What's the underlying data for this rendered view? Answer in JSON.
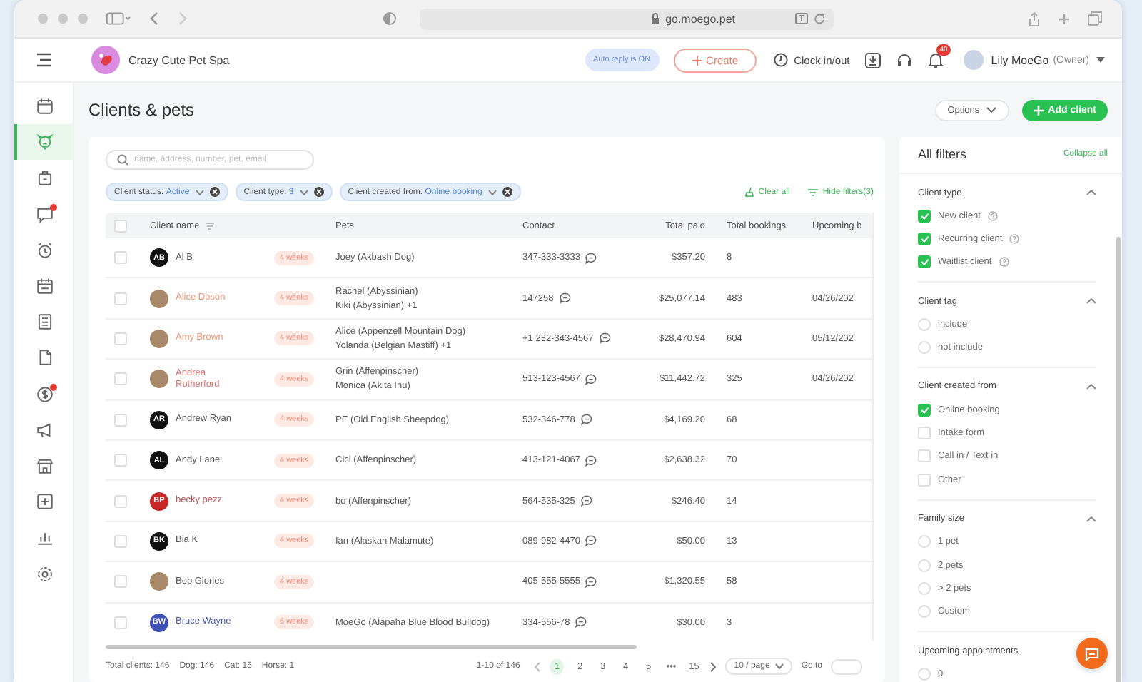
{
  "browser": {
    "url": "go.moego.pet"
  },
  "header": {
    "business": "Crazy Cute Pet Spa",
    "auto_reply": "Auto reply is ON",
    "create": "Create",
    "clock": "Clock in/out",
    "notifications": "40",
    "user": "Lily MoeGo",
    "role": "(Owner)"
  },
  "sidebar": {
    "items": [
      {
        "selected": false,
        "dot": false
      },
      {
        "selected": true,
        "dot": false
      },
      {
        "selected": false,
        "dot": false
      },
      {
        "selected": false,
        "dot": true
      },
      {
        "selected": false,
        "dot": false
      },
      {
        "selected": false,
        "dot": false
      },
      {
        "selected": false,
        "dot": false
      },
      {
        "selected": false,
        "dot": false
      },
      {
        "selected": false,
        "dot": true
      },
      {
        "selected": false,
        "dot": false
      },
      {
        "selected": false,
        "dot": false
      },
      {
        "selected": false,
        "dot": false
      },
      {
        "selected": false,
        "dot": false
      },
      {
        "selected": false,
        "dot": false
      }
    ]
  },
  "page": {
    "title": "Clients & pets",
    "options": "Options",
    "add_client": "Add client"
  },
  "search": {
    "placeholder": "name, address, number, pet, email"
  },
  "filter_chips": [
    {
      "label": "Client status:",
      "value": "Active"
    },
    {
      "label": "Client type:",
      "value": "3"
    },
    {
      "label": "Client created from:",
      "value": "Online booking"
    }
  ],
  "clear_all": "Clear all",
  "hide_filters": "Hide filters(3)",
  "table": {
    "select_all": false,
    "columns": [
      "Client name",
      "Pets",
      "Contact",
      "Total paid",
      "Total bookings",
      "Upcoming b"
    ],
    "rows": [
      {
        "selected": false,
        "name": "Al B",
        "color": "#555555",
        "avatar": {
          "kind": "initials",
          "initials": "AB",
          "color": "#111111"
        },
        "frequency": "4 weeks",
        "pets": [
          "Joey (Akbash Dog)"
        ],
        "contact": "347-333-3333",
        "total_paid": "$357.20",
        "total_bookings": "8"
      },
      {
        "selected": false,
        "name": "Alice Doson",
        "color": "#f09373",
        "avatar": {
          "kind": "photo"
        },
        "frequency": "4 weeks",
        "pets": [
          "Rachel (Abyssinian)",
          "Kiki (Abyssinian) +1"
        ],
        "contact": "147258",
        "total_paid": "$25,077.14",
        "total_bookings": "483",
        "upcoming": "04/26/202"
      },
      {
        "selected": false,
        "name": "Amy Brown",
        "color": "#f09373",
        "avatar": {
          "kind": "photo"
        },
        "frequency": "4 weeks",
        "pets": [
          "Alice (Appenzell Mountain Dog)",
          "Yolanda (Belgian Mastiff) +1"
        ],
        "contact": "+1 232-343-4567",
        "total_paid": "$28,470.94",
        "total_bookings": "604",
        "upcoming": "05/12/202"
      },
      {
        "selected": false,
        "name": "Andrea Rutherford",
        "color": "#d9706e",
        "avatar": {
          "kind": "photo"
        },
        "frequency": "4 weeks",
        "pets": [
          "Grin (Affenpinscher)",
          "Monica (Akita Inu)"
        ],
        "contact": "513-123-4567",
        "total_paid": "$11,442.72",
        "total_bookings": "325",
        "upcoming": "04/26/202"
      },
      {
        "selected": false,
        "name": "Andrew Ryan",
        "color": "#555555",
        "avatar": {
          "kind": "initials",
          "initials": "AR",
          "color": "#111111"
        },
        "frequency": "4 weeks",
        "pets": [
          "PE (Old English Sheepdog)"
        ],
        "contact": "532-346-778",
        "total_paid": "$4,169.20",
        "total_bookings": "68"
      },
      {
        "selected": false,
        "name": "Andy Lane",
        "color": "#555555",
        "avatar": {
          "kind": "initials",
          "initials": "AL",
          "color": "#111111"
        },
        "frequency": "4 weeks",
        "pets": [
          "Cici (Affenpinscher)"
        ],
        "contact": "413-121-4067",
        "total_paid": "$2,638.32",
        "total_bookings": "70"
      },
      {
        "selected": false,
        "name": "becky pezz",
        "color": "#c0504d",
        "avatar": {
          "kind": "initials",
          "initials": "BP",
          "color": "#c62828"
        },
        "frequency": "4 weeks",
        "pets": [
          "bo (Affenpinscher)"
        ],
        "contact": "564-535-325",
        "total_paid": "$246.40",
        "total_bookings": "14"
      },
      {
        "selected": false,
        "name": "Bia K",
        "color": "#555555",
        "avatar": {
          "kind": "initials",
          "initials": "BK",
          "color": "#111111"
        },
        "frequency": "4 weeks",
        "pets": [
          "Ian (Alaskan Malamute)"
        ],
        "contact": "089-982-4470",
        "total_paid": "$50.00",
        "total_bookings": "13"
      },
      {
        "selected": false,
        "name": "Bob Glories",
        "color": "#555555",
        "avatar": {
          "kind": "photo"
        },
        "frequency": "4 weeks",
        "pets": [],
        "contact": "405-555-5555",
        "total_paid": "$1,320.55",
        "total_bookings": "58"
      },
      {
        "selected": false,
        "name": "Bruce Wayne",
        "color": "#4a5bb0",
        "avatar": {
          "kind": "initials",
          "initials": "BW",
          "color": "#3f51b5"
        },
        "frequency": "6 weeks",
        "pets": [
          "MoeGo (Alapaha Blue Blood Bulldog)"
        ],
        "contact": "334-556-78",
        "total_paid": "$30.00",
        "total_bookings": "3"
      }
    ]
  },
  "footer": {
    "totals": [
      "Total clients: 146",
      "Dog: 146",
      "Cat: 15",
      "Horse: 1"
    ],
    "range": "1-10 of 146",
    "pages": [
      {
        "label": "1",
        "selected": true
      },
      {
        "label": "2",
        "selected": false
      },
      {
        "label": "3",
        "selected": false
      },
      {
        "label": "4",
        "selected": false
      },
      {
        "label": "5",
        "selected": false
      },
      {
        "label": "•••",
        "selected": false
      },
      {
        "label": "15",
        "selected": false
      }
    ],
    "page_size": "10 / page",
    "goto": "Go to"
  },
  "filters": {
    "title": "All filters",
    "collapse": "Collapse all",
    "sections": [
      {
        "title": "Client type",
        "expanded": true,
        "items": [
          {
            "kind": "checkbox",
            "label": "New client",
            "checked": true,
            "info": true
          },
          {
            "kind": "checkbox",
            "label": "Recurring client",
            "checked": true,
            "info": true
          },
          {
            "kind": "checkbox",
            "label": "Waitlist client",
            "checked": true,
            "info": true
          }
        ]
      },
      {
        "title": "Client tag",
        "expanded": true,
        "items": [
          {
            "kind": "radio",
            "label": "include",
            "checked": false,
            "info": false
          },
          {
            "kind": "radio",
            "label": "not include",
            "checked": false,
            "info": false
          }
        ]
      },
      {
        "title": "Client created from",
        "expanded": true,
        "items": [
          {
            "kind": "checkbox",
            "label": "Online booking",
            "checked": true,
            "info": false
          },
          {
            "kind": "checkbox",
            "label": "Intake form",
            "checked": false,
            "info": false
          },
          {
            "kind": "checkbox",
            "label": "Call in / Text in",
            "checked": false,
            "info": false
          },
          {
            "kind": "checkbox",
            "label": "Other",
            "checked": false,
            "info": false
          }
        ]
      },
      {
        "title": "Family size",
        "expanded": true,
        "items": [
          {
            "kind": "radio",
            "label": "1 pet",
            "checked": false,
            "info": false
          },
          {
            "kind": "radio",
            "label": "2 pets",
            "checked": false,
            "info": false
          },
          {
            "kind": "radio",
            "label": "> 2 pets",
            "checked": false,
            "info": false
          },
          {
            "kind": "radio",
            "label": "Custom",
            "checked": false,
            "info": false
          }
        ]
      },
      {
        "title": "Upcoming appointments",
        "expanded": true,
        "items": [
          {
            "kind": "radio",
            "label": "0",
            "checked": false,
            "info": false
          }
        ]
      }
    ]
  }
}
